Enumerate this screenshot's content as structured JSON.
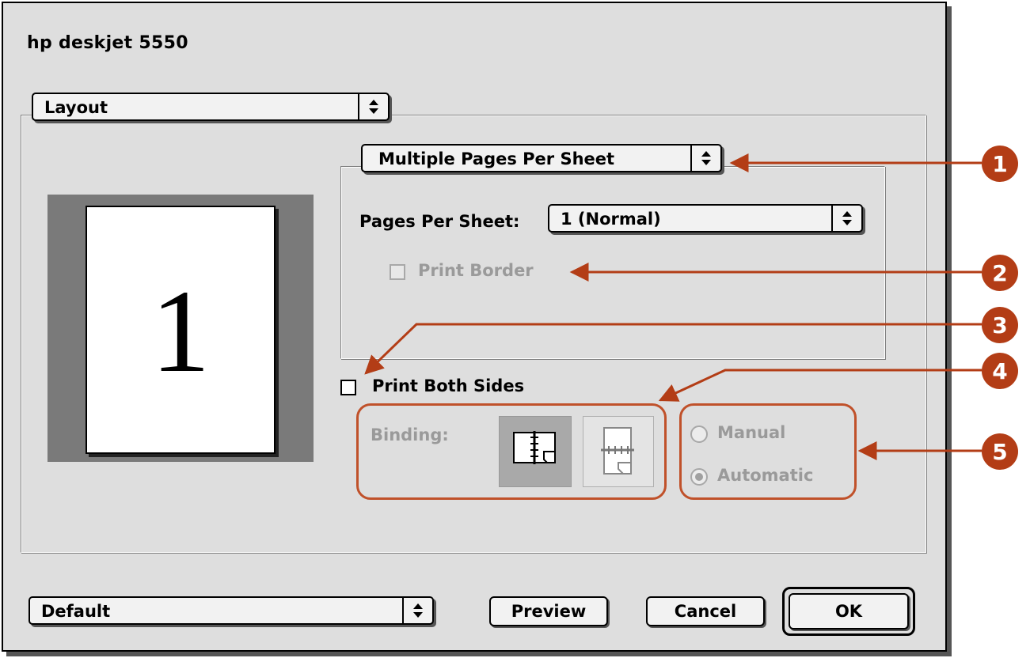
{
  "dialog": {
    "title": "hp deskjet 5550",
    "panel_menu": {
      "value": "Layout"
    },
    "layout_mode_menu": {
      "value": "Multiple Pages Per Sheet"
    },
    "pages_per_sheet": {
      "label": "Pages Per Sheet:",
      "value": "1 (Normal)"
    },
    "print_border": {
      "label": "Print Border",
      "checked": false,
      "enabled": false
    },
    "print_both_sides": {
      "label": "Print Both Sides",
      "checked": false
    },
    "binding": {
      "label": "Binding:",
      "options": [
        "left-edge-binding-icon",
        "top-edge-binding-icon"
      ],
      "selected": 0
    },
    "duplex_mode": {
      "options": [
        {
          "label": "Manual",
          "selected": false
        },
        {
          "label": "Automatic",
          "selected": true
        }
      ]
    },
    "preview": {
      "page_number": "1"
    },
    "settings_menu": {
      "value": "Default"
    },
    "buttons": {
      "preview": "Preview",
      "cancel": "Cancel",
      "ok": "OK"
    }
  },
  "callouts": [
    "1",
    "2",
    "3",
    "4",
    "5"
  ],
  "colors": {
    "callout": "#b33d16",
    "dialog_bg": "#dedede"
  }
}
